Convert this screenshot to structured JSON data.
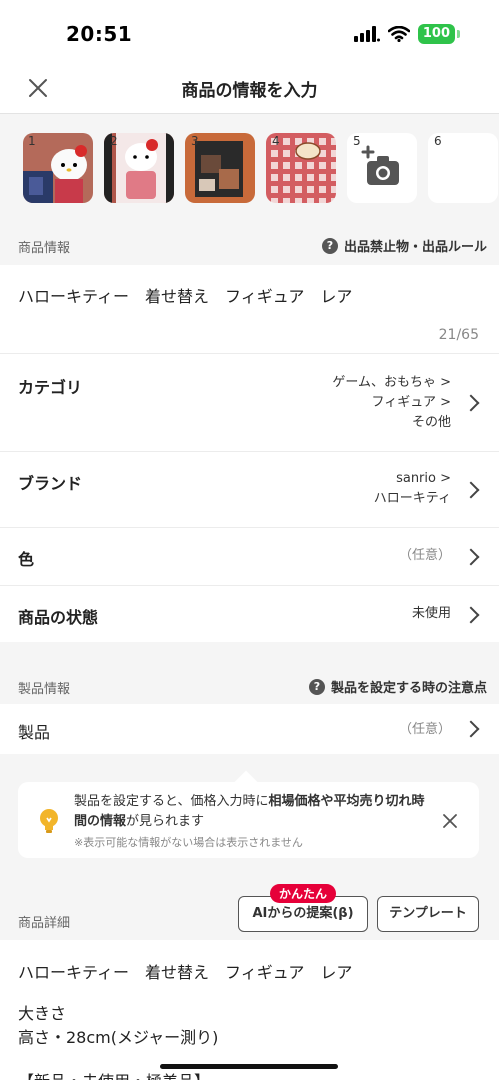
{
  "status": {
    "time": "20:51",
    "battery": "100"
  },
  "nav": {
    "title": "商品の情報を入力",
    "close_icon": "close-icon"
  },
  "photos": [
    {
      "num": "1"
    },
    {
      "num": "2"
    },
    {
      "num": "3"
    },
    {
      "num": "4"
    },
    {
      "num": "5",
      "icon": "add-camera-icon"
    },
    {
      "num": "6"
    }
  ],
  "item_info": {
    "section_label": "商品情報",
    "help_text": "出品禁止物・出品ルール",
    "title": "ハローキティー　着せ替え　フィギュア　レア",
    "char_count": "21/65"
  },
  "rows": {
    "category": {
      "label": "カテゴリ",
      "line1": "ゲーム、おもちゃ >",
      "line2": "フィギュア >",
      "line3": "その他"
    },
    "brand": {
      "label": "ブランド",
      "line1": "sanrio >",
      "line2": "ハローキティ"
    },
    "color": {
      "label": "色",
      "value": "（任意）"
    },
    "condition": {
      "label": "商品の状態",
      "value": "未使用"
    }
  },
  "product_info": {
    "section_label": "製品情報",
    "help_text": "製品を設定する時の注意点",
    "row_label": "製品",
    "row_value": "（任意）"
  },
  "tip": {
    "text_a": "製品を設定すると、価格入力時に",
    "text_b": "相場価格や平均売り切れ時間の情報",
    "text_c": "が見られます",
    "note": "※表示可能な情報がない場合は表示されません"
  },
  "details": {
    "section_label": "商品詳細",
    "badge": "かんたん",
    "ai_button": "AIからの提案(β)",
    "template_button": "テンプレート",
    "line1": "ハローキティー　着せ替え　フィギュア　レア",
    "line2": "大きさ",
    "line3": "高さ・28cm(メジャー測り)",
    "line4": "【新品・未使用・極美品】"
  },
  "colors": {
    "accent_red": "#e60039",
    "battery_green": "#2fc34a"
  }
}
